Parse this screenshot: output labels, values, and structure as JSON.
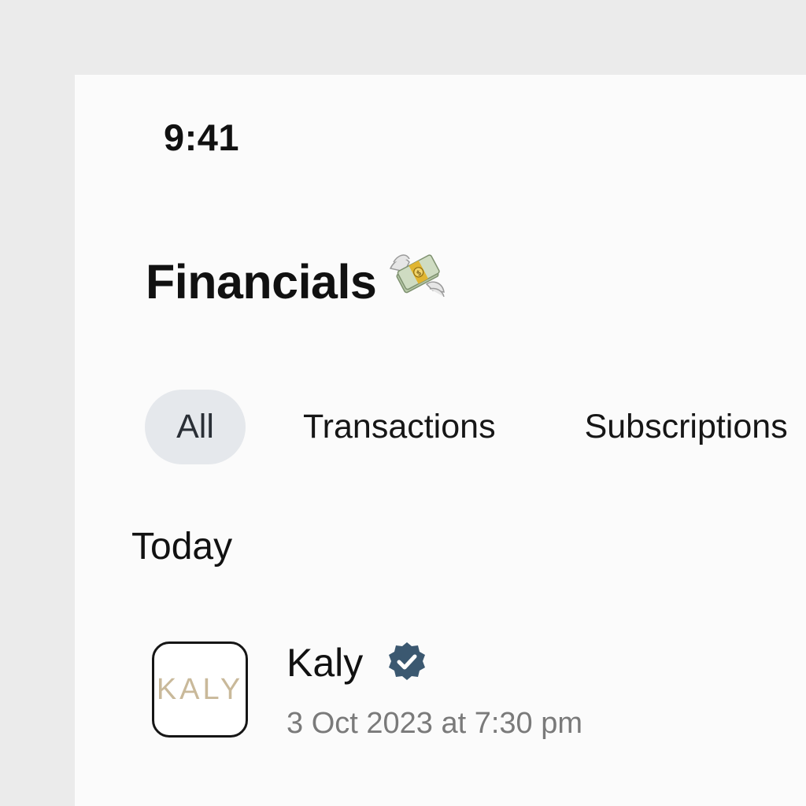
{
  "status_bar": {
    "time": "9:41"
  },
  "header": {
    "title": "Financials",
    "title_icon": "money-with-wings-icon"
  },
  "tabs": [
    {
      "label": "All",
      "selected": true
    },
    {
      "label": "Transactions",
      "selected": false
    },
    {
      "label": "Subscriptions",
      "selected": false
    }
  ],
  "sections": [
    {
      "label": "Today",
      "items": [
        {
          "merchant": "Kaly",
          "logo_text": "KALY",
          "verified": true,
          "datetime": "3 Oct 2023 at 7:30 pm"
        }
      ]
    }
  ],
  "colors": {
    "background": "#ebebeb",
    "screen": "#fbfbfb",
    "selected_tab": "#e5e8ec",
    "verified_badge": "#3b5870",
    "secondary_text": "#7a7a7a"
  }
}
